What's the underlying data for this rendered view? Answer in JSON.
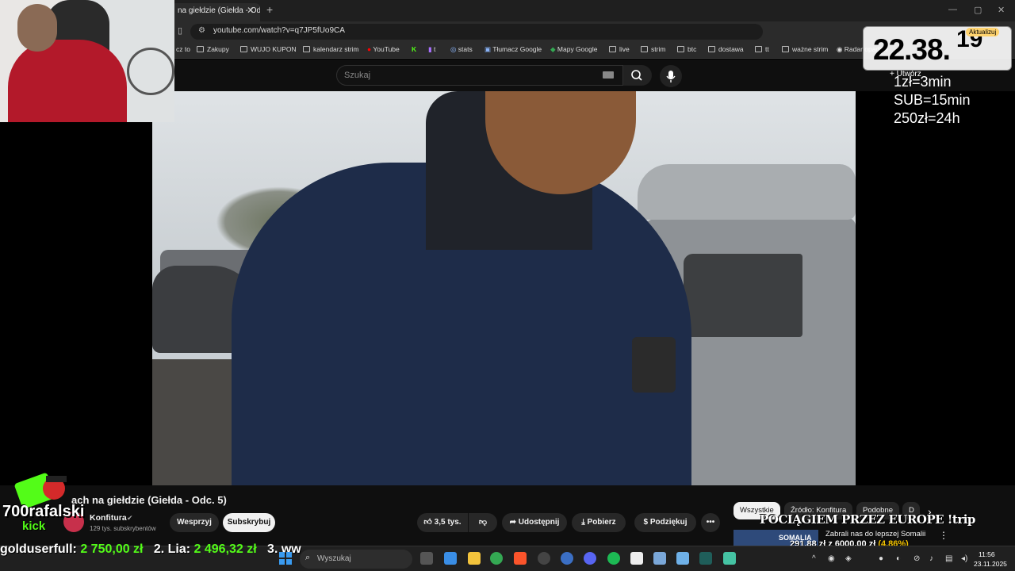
{
  "browser": {
    "tab_title": "na giełdzie (Giełda - Od...",
    "tab_close": "✕",
    "new_tab": "+",
    "url": "youtube.com/watch?v=q7JP5fUo9CA",
    "window_controls": [
      "—",
      "▢",
      "✕"
    ],
    "update_label": "Aktualizuj",
    "bookmarks": [
      "cz to",
      "Zakupy",
      "WUJO KUPON",
      "kalendarz strim",
      "YouTube",
      "t",
      "stats",
      "Tłumacz Google",
      "Mapy Google",
      "live",
      "strim",
      "btc",
      "dostawa",
      "tt",
      "ważne strim",
      "Radar opadów"
    ]
  },
  "youtube": {
    "search_placeholder": "Szukaj",
    "create_label": "+ Utwórz",
    "video_title": "ach na giełdzie (Giełda - Odc. 5)",
    "channel_name": "Konfitura",
    "verified": "✔",
    "subscribers": "129 tys. subskrybentów",
    "support_label": "Wesprzyj",
    "subscribe_label": "Subskrybuj",
    "likes": "3,5 tys.",
    "share_label": "Udostępnij",
    "download_label": "Pobierz",
    "thanks_label": "Podziękuj",
    "more_label": "•••",
    "chips": [
      "Wszystkie",
      "Źródło: Konfitura",
      "Podobne",
      "D"
    ],
    "chip_next": "›",
    "rec_thumb_label": "SOMALIA",
    "rec_title": "Zabrali nas do lepszej Somalii",
    "rec_menu": "⋮"
  },
  "stream_overlay": {
    "clock_time": "22.38.",
    "clock_small": "19",
    "rates": [
      "1zł=3min",
      "SUB=15min",
      "250zł=24h"
    ],
    "banner": "POCIĄGIEM PRZEZ EUROPE !trip",
    "goal_text": "291,88 zł z 6000,00 zł ",
    "goal_pct": "(4.86%)",
    "logo_name": "700rafalski",
    "logo_sub": "kick",
    "ticker": [
      {
        "name": "golduserfull: ",
        "amount": "2 750,00 zł"
      },
      {
        "name": "2. Lia: ",
        "amount": "2 496,32 zł"
      },
      {
        "name": "3. ww",
        "amount": ""
      }
    ]
  },
  "taskbar": {
    "search_placeholder": "Wyszukaj",
    "time": "11:56",
    "date": "23.11.2025",
    "tray_overflow": "^"
  },
  "colors": {
    "kick_green": "#53fc18",
    "yt_dark": "#0f0f0f",
    "goal_yellow": "#f5c400"
  }
}
